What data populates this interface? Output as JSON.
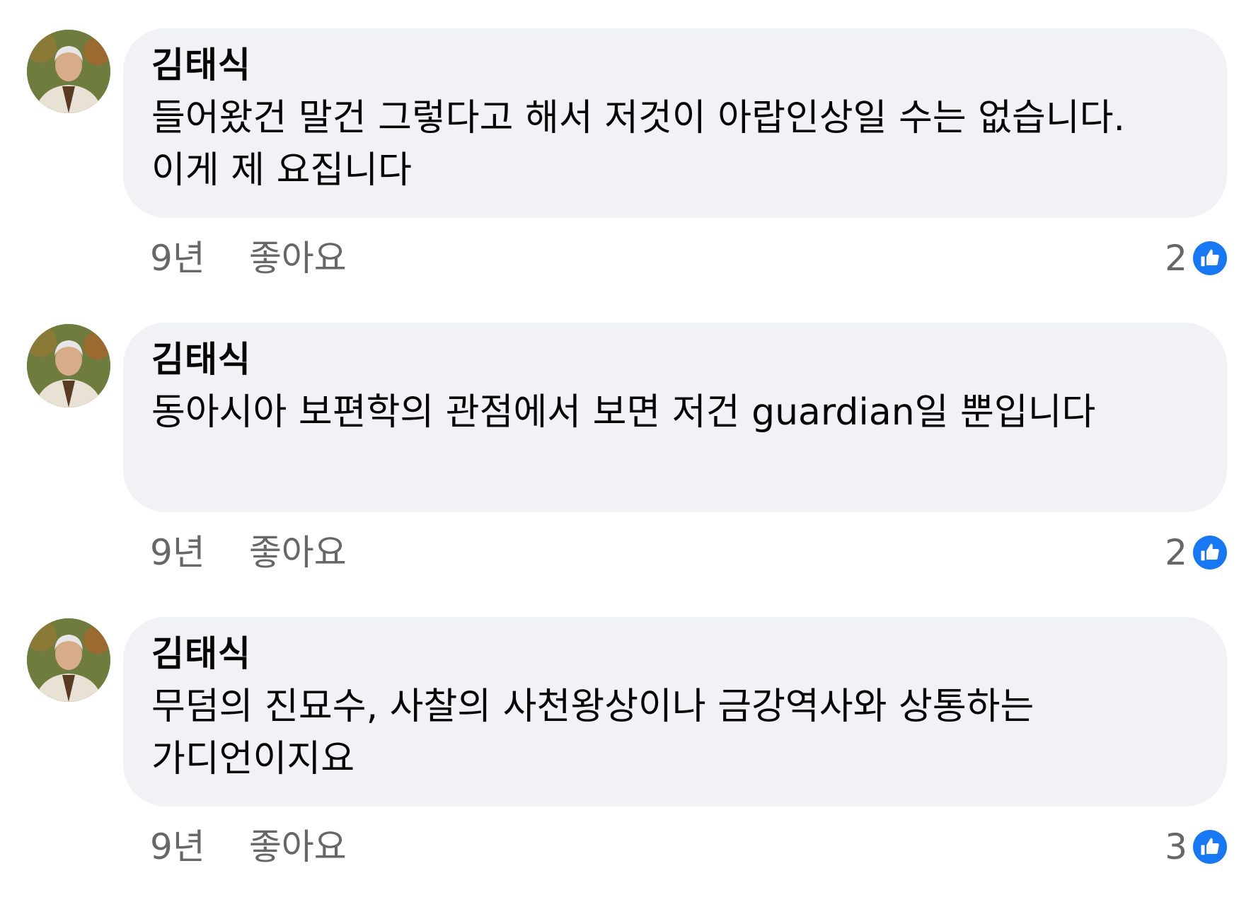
{
  "comments": [
    {
      "author": "김태식",
      "text": "들어왔건 말건 그렇다고 해서 저것이 아랍인상일 수는 없습니다. 이게 제 요집니다",
      "time": "9년",
      "like_label": "좋아요",
      "reaction_count": "2",
      "reaction_icon": "thumbs-up-icon"
    },
    {
      "author": "김태식",
      "text": "동아시아 보편학의 관점에서 보면 저건 guardian일 뿐입니다",
      "time": "9년",
      "like_label": "좋아요",
      "reaction_count": "2",
      "reaction_icon": "thumbs-up-icon"
    },
    {
      "author": "김태식",
      "text": "무덤의 진묘수, 사찰의 사천왕상이나 금강역사와 상통하는 가디언이지요",
      "time": "9년",
      "like_label": "좋아요",
      "reaction_count": "3",
      "reaction_icon": "thumbs-up-icon"
    }
  ],
  "colors": {
    "bubble": "#f0f2f5",
    "text": "#050505",
    "secondary_text": "#65676b",
    "like_blue": "#1877f2"
  }
}
